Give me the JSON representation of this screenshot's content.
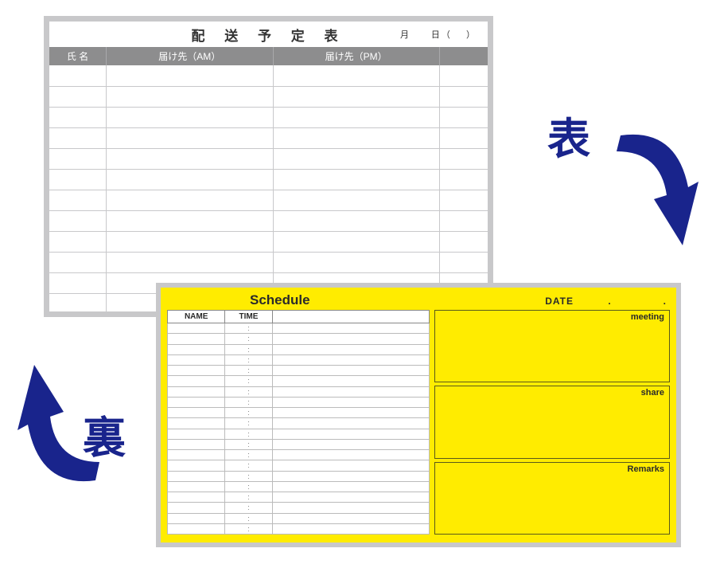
{
  "front": {
    "title": "配 送 予 定 表",
    "date_labels": "月　　日（　 ）",
    "columns": {
      "name": "氏 名",
      "am": "届け先（AM）",
      "pm": "届け先（PM）",
      "blank": ""
    },
    "row_count": 12,
    "badge": "表"
  },
  "back": {
    "title": "Schedule",
    "date_label": "DATE　　　 .　　　　　.",
    "columns": {
      "name": "NAME",
      "time": "TIME",
      "task": ""
    },
    "time_placeholder": ":",
    "row_count": 20,
    "sections": {
      "meeting": "meeting",
      "share": "share",
      "remarks": "Remarks"
    },
    "badge": "裏"
  },
  "colors": {
    "accent": "#19248c",
    "yellow": "#ffec00",
    "frame": "#c8c8ca",
    "header": "#8d8d8e"
  }
}
